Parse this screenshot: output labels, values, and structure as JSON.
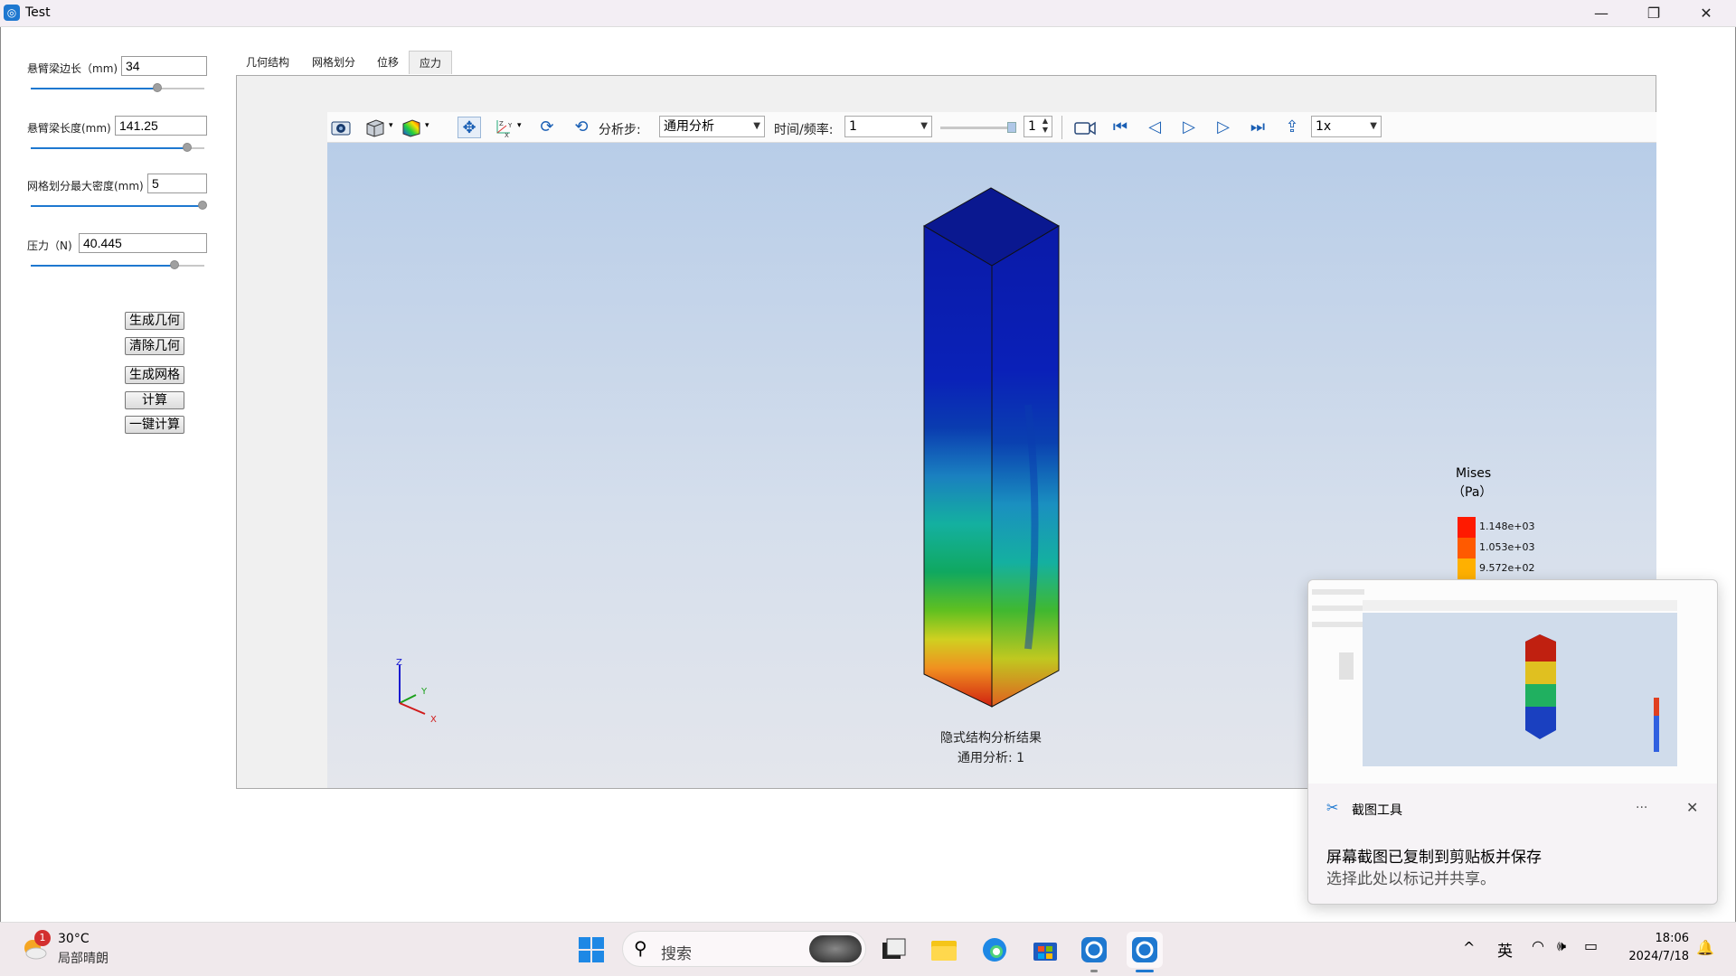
{
  "window": {
    "title": "Test",
    "app_icon": "app-logo-icon",
    "minimize": "—",
    "maximize": "❐",
    "close": "✕"
  },
  "params": [
    {
      "label": "悬臂梁边长（mm)",
      "value": "34",
      "slider": 0.73
    },
    {
      "label": "悬臂梁长度(mm)",
      "value": "141.25",
      "slider": 0.9
    },
    {
      "label": "网格划分最大密度(mm)",
      "value": "5",
      "slider": 0.99
    },
    {
      "label": "压力（N)",
      "value": "40.445",
      "slider": 0.83
    }
  ],
  "buttons": [
    "生成几何",
    "清除几何",
    "生成网格",
    "计算",
    "一键计算"
  ],
  "tabs": [
    {
      "label": "几何结构",
      "active": false
    },
    {
      "label": "网格划分",
      "active": false
    },
    {
      "label": "位移",
      "active": false
    },
    {
      "label": "应力",
      "active": true
    }
  ],
  "toolbar": {
    "analysis_step_label": "分析步:",
    "analysis_step_value": "通用分析",
    "time_freq_label": "时间/频率:",
    "time_freq_value": "1",
    "frame_value": "1",
    "speed_value": "1x"
  },
  "viewport": {
    "caption_line1": "隐式结构分析结果",
    "caption_line2": "通用分析: 1",
    "axis_z": "Z",
    "axis_y": "Y",
    "axis_x": "X"
  },
  "legend": {
    "title": "Mises",
    "unit": "（Pa）",
    "entries": [
      {
        "label": "1.148e+03",
        "color": "#ff1a00"
      },
      {
        "label": "1.053e+03",
        "color": "#ff5a00"
      },
      {
        "label": "9.572e+02",
        "color": "#ffb000"
      }
    ]
  },
  "notification": {
    "app_name": "截图工具",
    "more": "···",
    "close": "✕",
    "title": "屏幕截图已复制到剪贴板并保存",
    "subtitle": "选择此处以标记并共享。"
  },
  "taskbar": {
    "weather_badge": "1",
    "temperature": "30°C",
    "weather_desc": "局部晴朗",
    "search_placeholder": "搜索",
    "ime": "英",
    "time": "18:06",
    "date": "2024/7/18",
    "chevron": "^"
  },
  "colors": {
    "accent": "#1e78d0",
    "taskbar_bg": "#f0e9ec"
  }
}
